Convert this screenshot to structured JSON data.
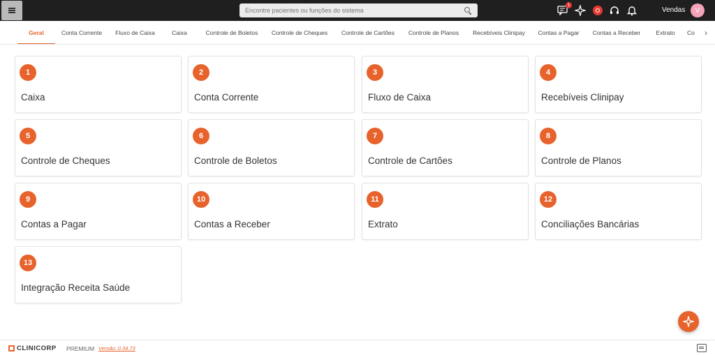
{
  "topbar": {
    "search_placeholder": "Encontre pacientes ou funções do sistema",
    "notification_count": "1",
    "user_name": "Vendas",
    "avatar_initial": "V"
  },
  "tabs": [
    {
      "label": "Geral",
      "active": true
    },
    {
      "label": "Conta Corrente"
    },
    {
      "label": "Fluxo de Caixa"
    },
    {
      "label": "Caixa"
    },
    {
      "label": "Controle de Boletos"
    },
    {
      "label": "Controle de Cheques"
    },
    {
      "label": "Controle de Cartões"
    },
    {
      "label": "Controle de Planos"
    },
    {
      "label": "Recebíveis Clinipay"
    },
    {
      "label": "Contas a Pagar"
    },
    {
      "label": "Contas a Receber"
    },
    {
      "label": "Extrato"
    },
    {
      "label": "Co"
    }
  ],
  "cards": [
    {
      "number": "1",
      "title": "Caixa"
    },
    {
      "number": "2",
      "title": "Conta Corrente"
    },
    {
      "number": "3",
      "title": "Fluxo de Caixa"
    },
    {
      "number": "4",
      "title": "Recebíveis Clinipay"
    },
    {
      "number": "5",
      "title": "Controle de Cheques"
    },
    {
      "number": "6",
      "title": "Controle de Boletos"
    },
    {
      "number": "7",
      "title": "Controle de Cartões"
    },
    {
      "number": "8",
      "title": "Controle de Planos"
    },
    {
      "number": "9",
      "title": "Contas a Pagar"
    },
    {
      "number": "10",
      "title": "Contas a Receber"
    },
    {
      "number": "11",
      "title": "Extrato"
    },
    {
      "number": "12",
      "title": "Conciliações Bancárias"
    },
    {
      "number": "13",
      "title": "Integração Receita Saúde"
    }
  ],
  "footer": {
    "brand": "CLINICORP",
    "plan": "PREMIUM",
    "version": "Versão: 0.34.73"
  },
  "colors": {
    "accent": "#e8622b",
    "topbar": "#1f1f1f",
    "badge": "#e53935",
    "avatar": "#f5a3b8"
  },
  "icons": {
    "menu": "hamburger-icon",
    "search": "search-icon",
    "messages": "chat-notification-icon",
    "assistant": "sparkle-icon",
    "record": "record-icon",
    "support": "headset-icon",
    "notifications": "bell-icon",
    "fab": "sparkle-icon",
    "feedback": "chat-icon"
  }
}
